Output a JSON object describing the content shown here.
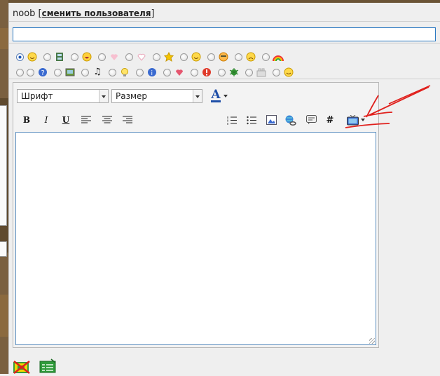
{
  "user": {
    "name": "noob",
    "bracket_open": "[",
    "change_link": "сменить пользователя",
    "bracket_close": "]"
  },
  "subject": {
    "value": "",
    "placeholder": ""
  },
  "smiles": {
    "row1": [
      "none",
      "smile",
      "film",
      "laugh",
      "heart-pink",
      "heart-empty",
      "star",
      "grin",
      "cool",
      "sad",
      "rainbow"
    ],
    "row2": [
      "blank",
      "question",
      "picture",
      "music",
      "idea",
      "info",
      "heart",
      "exclamation",
      "bug",
      "lego",
      "happy"
    ]
  },
  "toolbar": {
    "font_select": "Шрифт",
    "size_select": "Размер",
    "font_color": "A",
    "bold": "B",
    "italic": "I",
    "underline": "U",
    "code": "#"
  },
  "message": {
    "value": ""
  },
  "colors": {
    "accent": "#2b79c2",
    "annotation": "#e0201c",
    "border_strip": "#6b5436"
  }
}
